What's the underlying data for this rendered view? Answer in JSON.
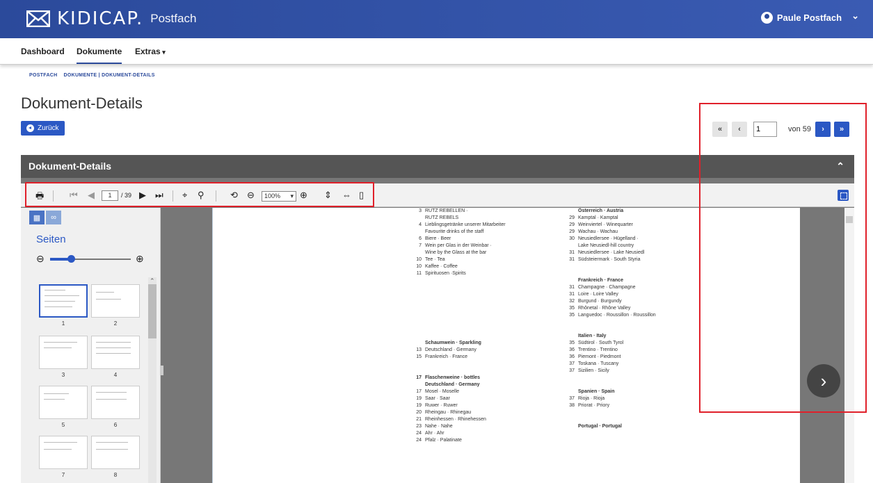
{
  "header": {
    "brand": "KIDICAP.",
    "product": "Postfach",
    "user_name": "Paule Postfach",
    "user_chevron": "⌄"
  },
  "nav": {
    "items": [
      "Dashboard",
      "Dokumente",
      "Extras"
    ]
  },
  "breadcrumb": {
    "root": "POSTFACH",
    "section": "DOKUMENTE",
    "separator": "|",
    "current": "DOKUMENT-DETAILS"
  },
  "page": {
    "title": "Dokument-Details",
    "back_label": "Zurück"
  },
  "pager": {
    "first": "«",
    "prev": "‹",
    "current": "1",
    "of_label": "von 59",
    "next": "›",
    "last": "»"
  },
  "panel": {
    "title": "Dokument-Details"
  },
  "pdf_toolbar": {
    "page_current": "1",
    "page_total": "/ 39",
    "zoom": "100%"
  },
  "sidebar": {
    "title": "Seiten",
    "thumb_labels": [
      "1",
      "2",
      "3",
      "4",
      "5",
      "6",
      "7",
      "8"
    ]
  },
  "document": {
    "left_col": [
      {
        "n": "3",
        "t": "RUTZ REBELLEN ·",
        "h": false
      },
      {
        "n": "",
        "t": "RUTZ REBELS",
        "h": false
      },
      {
        "n": "4",
        "t": "Lieblingsgetränke unserer Mitarbeiter",
        "h": false
      },
      {
        "n": "",
        "t": "Favourite drinks of the staff",
        "h": false
      },
      {
        "n": "6",
        "t": "Biere · Beer",
        "h": false
      },
      {
        "n": "7",
        "t": "Wein per Glas in der Weinbar ·",
        "h": false
      },
      {
        "n": "",
        "t": "Wine by the Glass at the bar",
        "h": false
      },
      {
        "n": "10",
        "t": "Tee · Tea",
        "h": false
      },
      {
        "n": "10",
        "t": "Kaffee · Coffee",
        "h": false
      },
      {
        "n": "11",
        "t": "Spirituosen ·Spirits",
        "h": false
      },
      {
        "n": "",
        "t": "",
        "h": false
      },
      {
        "n": "",
        "t": "",
        "h": false
      },
      {
        "n": "",
        "t": "",
        "h": false
      },
      {
        "n": "",
        "t": "",
        "h": false
      },
      {
        "n": "",
        "t": "",
        "h": false
      },
      {
        "n": "",
        "t": "",
        "h": false
      },
      {
        "n": "",
        "t": "",
        "h": false
      },
      {
        "n": "",
        "t": "",
        "h": false
      },
      {
        "n": "",
        "t": "",
        "h": false
      },
      {
        "n": "",
        "t": "Schaumwein · Sparkling",
        "h": true
      },
      {
        "n": "13",
        "t": "Deutschland · Germany",
        "h": false
      },
      {
        "n": "15",
        "t": "Frankreich · France",
        "h": false
      },
      {
        "n": "",
        "t": "",
        "h": false
      },
      {
        "n": "",
        "t": "",
        "h": false
      },
      {
        "n": "17",
        "t": "Flaschenweine · bottles",
        "h": true
      },
      {
        "n": "",
        "t": "Deutschland · Germany",
        "h": true
      },
      {
        "n": "17",
        "t": "Mosel · Moselle",
        "h": false
      },
      {
        "n": "19",
        "t": "Saar · Saar",
        "h": false
      },
      {
        "n": "19",
        "t": "Ruwer · Ruwer",
        "h": false
      },
      {
        "n": "20",
        "t": "Rheingau · Rhinegau",
        "h": false
      },
      {
        "n": "21",
        "t": "Rheinhessen · Rhinehessen",
        "h": false
      },
      {
        "n": "23",
        "t": "Nahe · Nahe",
        "h": false
      },
      {
        "n": "24",
        "t": "Ahr · Ahr",
        "h": false
      },
      {
        "n": "24",
        "t": "Pfalz · Palatinate",
        "h": false
      }
    ],
    "right_col": [
      {
        "n": "",
        "t": "Österreich · Austria",
        "h": true
      },
      {
        "n": "29",
        "t": "Kamptal · Kamptal",
        "h": false
      },
      {
        "n": "29",
        "t": "Weinviertel · Winequarter",
        "h": false
      },
      {
        "n": "29",
        "t": "Wachau · Wachau",
        "h": false
      },
      {
        "n": "30",
        "t": "Neusiedlersee · Hügelland ·",
        "h": false
      },
      {
        "n": "",
        "t": "Lake Neusiedl-hill country",
        "h": false
      },
      {
        "n": "31",
        "t": "Neusiedlersee · Lake Neusiedl",
        "h": false
      },
      {
        "n": "31",
        "t": "Südsteiermark · South Styria",
        "h": false
      },
      {
        "n": "",
        "t": "",
        "h": false
      },
      {
        "n": "",
        "t": "",
        "h": false
      },
      {
        "n": "",
        "t": "Frankreich · France",
        "h": true
      },
      {
        "n": "31",
        "t": "Champagne · Champagne",
        "h": false
      },
      {
        "n": "31",
        "t": "Loire · Loire Valley",
        "h": false
      },
      {
        "n": "32",
        "t": "Burgund · Burgundy",
        "h": false
      },
      {
        "n": "35",
        "t": "Rhônetal · Rhône Valley",
        "h": false
      },
      {
        "n": "35",
        "t": "Languedoc · Roussillon · Roussillon",
        "h": false
      },
      {
        "n": "",
        "t": "",
        "h": false
      },
      {
        "n": "",
        "t": "",
        "h": false
      },
      {
        "n": "",
        "t": "Italien · Italy",
        "h": true
      },
      {
        "n": "35",
        "t": "Südtirol · South Tyrol",
        "h": false
      },
      {
        "n": "36",
        "t": "Trentino · Trentino",
        "h": false
      },
      {
        "n": "36",
        "t": "Piemont · Piedmont",
        "h": false
      },
      {
        "n": "37",
        "t": "Toskana · Tuscany",
        "h": false
      },
      {
        "n": "37",
        "t": "Sizilien · Sicily",
        "h": false
      },
      {
        "n": "",
        "t": "",
        "h": false
      },
      {
        "n": "",
        "t": "",
        "h": false
      },
      {
        "n": "",
        "t": "Spanien · Spain",
        "h": true
      },
      {
        "n": "37",
        "t": "Rioja · Rioja",
        "h": false
      },
      {
        "n": "38",
        "t": "Priorat · Priory",
        "h": false
      },
      {
        "n": "",
        "t": "",
        "h": false
      },
      {
        "n": "",
        "t": "",
        "h": false
      },
      {
        "n": "",
        "t": "Portugal · Portugal",
        "h": true
      }
    ]
  },
  "colors": {
    "brand": "#2b4a9b",
    "primary": "#2b58c4",
    "highlight": "#e0202a",
    "panel_header": "#555555"
  }
}
